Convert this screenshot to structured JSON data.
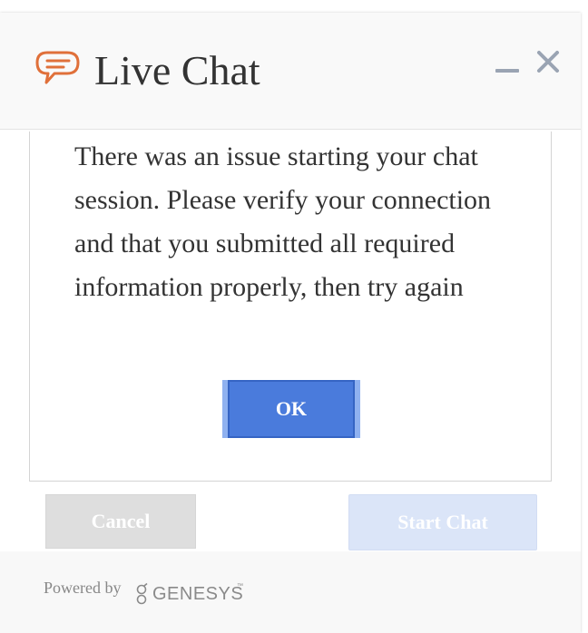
{
  "header": {
    "title": "Live Chat",
    "icons": {
      "chat": "chat-bubble-icon",
      "minimize": "minimize-icon",
      "close": "close-icon"
    }
  },
  "dialog": {
    "message": "There was an issue starting your chat session. Please verify your connection and that you submitted all required information properly, then try again",
    "ok_label": "OK"
  },
  "actions": {
    "cancel_label": "Cancel",
    "start_chat_label": "Start Chat"
  },
  "footer": {
    "powered_by": "Powered by",
    "brand": "GENESYS",
    "trademark": "™"
  },
  "colors": {
    "accent": "#e0703a",
    "primary_button": "#4a7bdc",
    "start_chat_disabled": "#dbe5f8",
    "cancel_disabled": "#dedede",
    "text": "#333333",
    "icon_gray": "#9aa4b3"
  }
}
